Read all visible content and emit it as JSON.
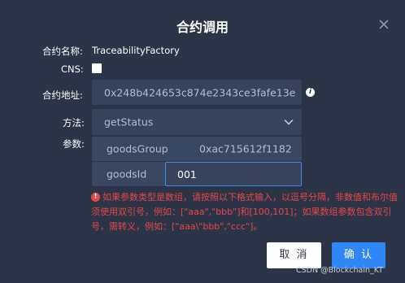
{
  "dialog": {
    "title": "合约调用",
    "close_icon": "close-icon"
  },
  "form": {
    "name_label": "合约名称:",
    "name_value": "TraceabilityFactory",
    "cns_label": "CNS:",
    "cns_checked": false,
    "address_label": "合约地址:",
    "address_value": "0x248b424653c874e2343ce3fafe13e",
    "method_label": "方法:",
    "method_value": "getStatus",
    "params_label": "参数:",
    "params": [
      {
        "name": "goodsGroup",
        "value": "0xac715612f1182"
      },
      {
        "name": "goodsId",
        "value": "001"
      }
    ],
    "hint_icon": "error-circle-icon",
    "hint_text": "如果参数类型是数组，请按照以下格式输入，以逗号分隔，非数值和布尔值须使用双引号，例如：[\"aaa\",\"bbb\"]和[100,101]；如果数组参数包含双引号，需转义，例如：[\"aaa\\\"bbb\",\"ccc\"]。"
  },
  "buttons": {
    "cancel": "取 消",
    "ok": "确 认"
  },
  "watermark": "CSDN @Blockchain_KT",
  "colors": {
    "background": "#2b3547",
    "field": "#36435a",
    "accent": "#2f87f5",
    "error": "#e84545"
  }
}
